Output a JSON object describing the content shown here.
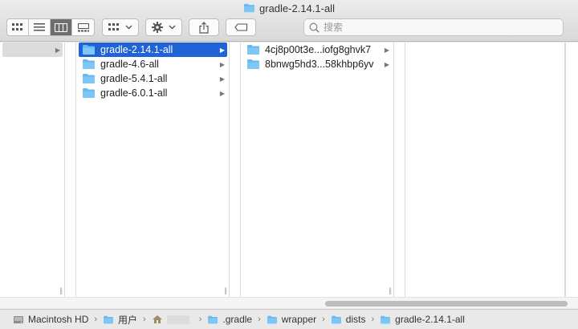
{
  "window": {
    "title": "gradle-2.14.1-all"
  },
  "toolbar": {
    "search_placeholder": "搜索"
  },
  "columns": {
    "col1": {
      "items": [
        {
          "label": ""
        }
      ]
    },
    "col2": {
      "items": [
        {
          "label": "gradle-2.14.1-all",
          "selected": true
        },
        {
          "label": "gradle-4.6-all"
        },
        {
          "label": "gradle-5.4.1-all"
        },
        {
          "label": "gradle-6.0.1-all"
        }
      ]
    },
    "col3": {
      "items": [
        {
          "label": "4cj8p00t3e...iofg8ghvk7"
        },
        {
          "label": "8bnwg5hd3...58khbp6yv"
        }
      ]
    }
  },
  "pathbar": {
    "items": [
      {
        "label": "Macintosh HD",
        "icon": "hard-drive-icon"
      },
      {
        "label": "用户",
        "icon": "folder-icon"
      },
      {
        "label": "",
        "icon": "home-icon"
      },
      {
        "label": ".gradle",
        "icon": "folder-icon"
      },
      {
        "label": "wrapper",
        "icon": "folder-icon"
      },
      {
        "label": "dists",
        "icon": "folder-icon"
      },
      {
        "label": "gradle-2.14.1-all",
        "icon": "folder-icon"
      }
    ]
  },
  "colors": {
    "selection": "#1f63d6",
    "folder": "#5fb4ef"
  }
}
